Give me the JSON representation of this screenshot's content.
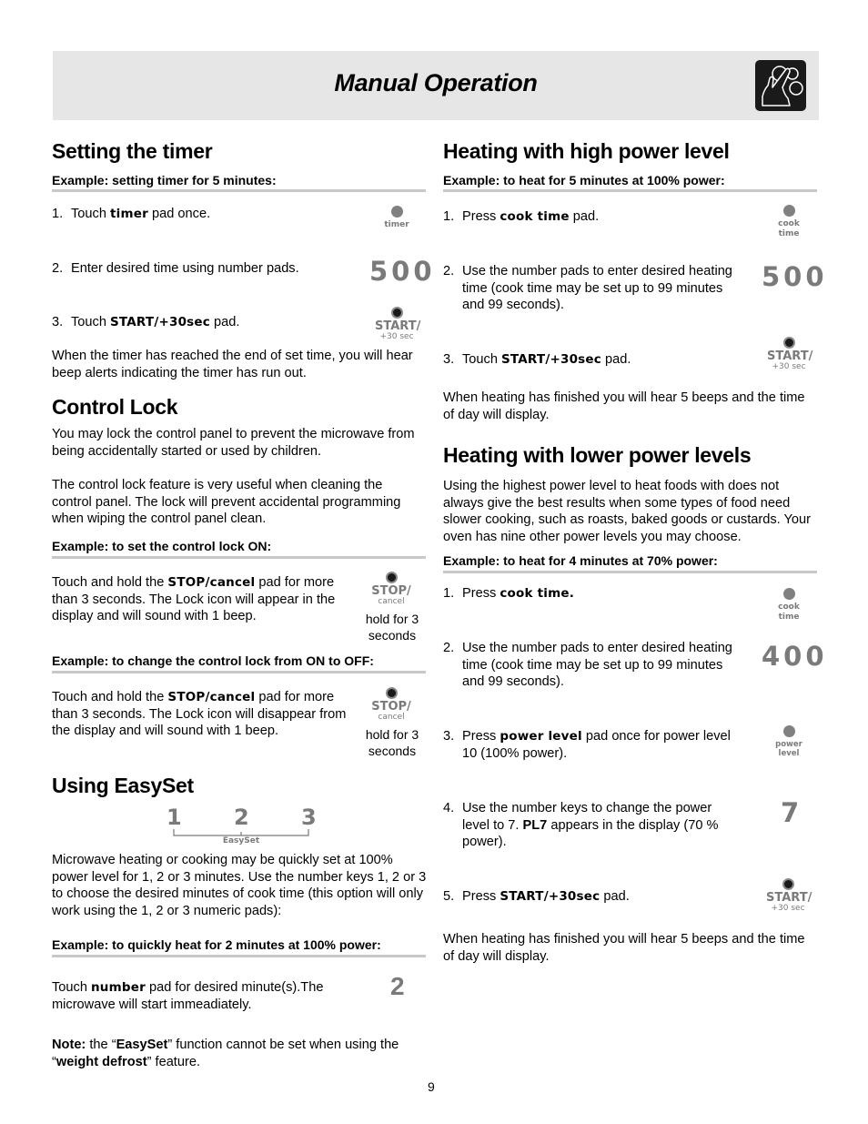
{
  "header": {
    "title": "Manual Operation",
    "icon": "hand-touch-icon"
  },
  "timer": {
    "title": "Setting the timer",
    "example": "Example: setting timer for 5 minutes:",
    "steps": [
      {
        "num": "1.",
        "pre": "Touch ",
        "bold": "timer",
        "post": " pad once.",
        "pad_label": "timer"
      },
      {
        "num": "2.",
        "text": "Enter desired time using number pads.",
        "display": "500"
      },
      {
        "num": "3.",
        "pre": "Touch ",
        "bold": "START/+30sec",
        "post": " pad.",
        "pad_label_main": "START/",
        "pad_label_sub": "+30 sec"
      }
    ],
    "footer": "When the timer has reached the end of set time, you will hear beep alerts indicating the timer has run out."
  },
  "control_lock": {
    "title": "Control Lock",
    "para1": "You may lock the control panel to prevent the microwave from being accidentally started or used by children.",
    "para2": "The control lock feature is very useful when cleaning the control panel. The lock will prevent accidental programming when wiping the control panel clean.",
    "example_on": "Example: to set the control lock ON:",
    "on_pre": "Touch and hold the ",
    "on_bold": "STOP/cancel",
    "on_post": " pad for more than 3 seconds. The Lock icon will appear in the display and will sound with 1 beep.",
    "example_off": "Example: to change the control lock from ON to OFF:",
    "off_pre": "Touch and hold the ",
    "off_bold": "STOP/cancel",
    "off_post": " pad for more than 3 seconds. The Lock icon will disappear from the display and will sound with 1 beep.",
    "pad_label_main": "STOP/",
    "pad_label_sub": "cancel",
    "hold_text": "hold for 3 seconds"
  },
  "easyset": {
    "title": "Using EasySet",
    "keys": [
      "1",
      "2",
      "3"
    ],
    "keys_label": "EasySet",
    "para": "Microwave heating or cooking may be quickly set at 100% power level for 1, 2 or 3 minutes. Use the number keys  1, 2 or 3 to choose the desired minutes of cook time (this option will only work using the 1, 2 or 3 numeric pads):",
    "example": "Example: to quickly heat for 2 minutes at 100% power:",
    "step_pre": "Touch ",
    "step_bold": "number",
    "step_post": " pad for desired minute(s).The microwave will start immeadiately.",
    "display": "2",
    "note_label": "Note:",
    "note_pre": " the “",
    "note_bold1": "EasySet",
    "note_mid": "” function cannot be set when using the “",
    "note_bold2": "weight defrost",
    "note_post": "” feature."
  },
  "high_power": {
    "title": "Heating with high power level",
    "example": "Example: to heat for 5 minutes at 100% power:",
    "steps": [
      {
        "num": "1.",
        "pre": "Press ",
        "bold": "cook time",
        "post": " pad.",
        "pad_label_1": "cook",
        "pad_label_2": "time"
      },
      {
        "num": "2.",
        "text": "Use the number pads to enter desired heating time (cook time may be set up to 99 minutes and 99 seconds).",
        "display": "500"
      },
      {
        "num": "3.",
        "pre": "Touch ",
        "bold": "START/+30sec",
        "post": " pad.",
        "pad_label_main": "START/",
        "pad_label_sub": "+30 sec"
      }
    ],
    "footer": "When heating has finished you will hear 5 beeps and the time of day will display."
  },
  "lower_power": {
    "title": "Heating with lower power levels",
    "para": "Using the highest power level to heat foods with does not always give the best results when some types of food need slower cooking, such as roasts, baked goods or custards. Your oven has nine other power levels you may choose.",
    "example": "Example: to heat for 4 minutes at 70% power:",
    "steps": [
      {
        "num": "1.",
        "pre": "Press ",
        "bold": "cook time.",
        "post": "",
        "pad_label_1": "cook",
        "pad_label_2": "time"
      },
      {
        "num": "2.",
        "text": "Use the number pads to enter desired heating time (cook time may be set up to 99 minutes and 99 seconds).",
        "display": "400"
      },
      {
        "num": "3.",
        "pre": "Press ",
        "bold": "power level",
        "post": " pad once for power level 10 (100% power).",
        "pad_label_1": "power",
        "pad_label_2": "level"
      },
      {
        "num": "4.",
        "pre": "Use the number keys to change the power level to 7. ",
        "bold": "PL7",
        "post": " appears in the display (70 % power).",
        "display": "7"
      },
      {
        "num": "5.",
        "pre": "Press ",
        "bold": "START/+30sec",
        "post": " pad.",
        "pad_label_main": "START/",
        "pad_label_sub": "+30 sec"
      }
    ],
    "footer": "When heating has finished you will hear 5 beeps and the time of day will display."
  },
  "page_number": "9"
}
